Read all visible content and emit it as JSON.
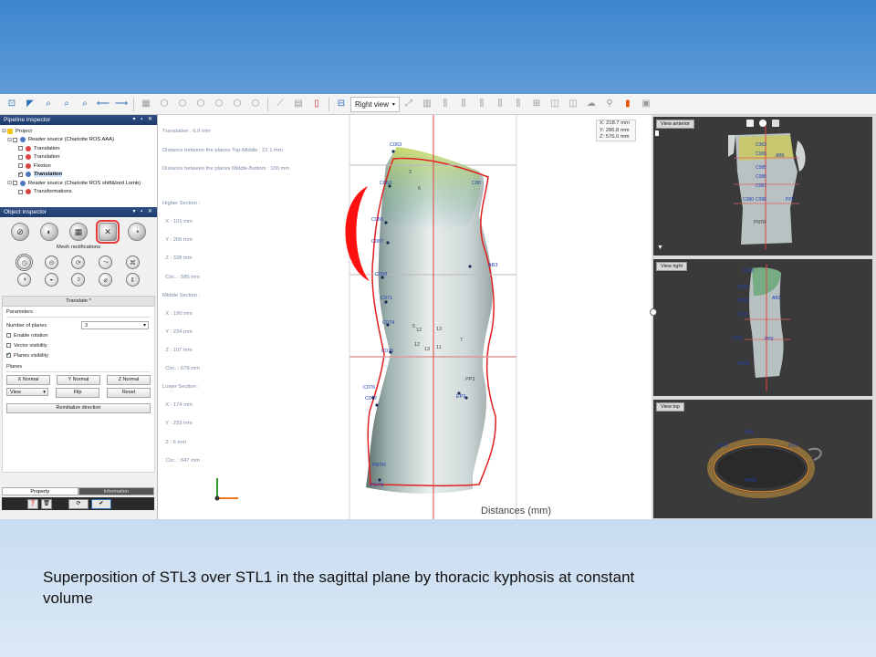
{
  "toolbar": {
    "view_select": "Right view",
    "icons": [
      "arrow-icon",
      "pointer-icon",
      "zoom-icon",
      "zoom-icon",
      "zoom-icon",
      "back-icon",
      "forward-icon",
      "grid-icon",
      "cube-icon",
      "cube-icon",
      "cube-icon",
      "cube-icon",
      "cube-icon",
      "cube-icon",
      "ruler-icon",
      "slice-icon",
      "cylinder-icon"
    ]
  },
  "pipeline_inspector": {
    "title": "Pipeline inspector",
    "items": [
      {
        "label": "Project",
        "level": 0
      },
      {
        "label": "Reader source (Charlotte ROS AAA)",
        "level": 1
      },
      {
        "label": "Translation",
        "level": 2
      },
      {
        "label": "Translation",
        "level": 2
      },
      {
        "label": "Flexion",
        "level": 2
      },
      {
        "label": "Translation",
        "level": 2,
        "selected": true
      },
      {
        "label": "Reader source (Charlotte ROS shift&lord Lomb)",
        "level": 1
      },
      {
        "label": "Transformations",
        "level": 2
      }
    ]
  },
  "object_inspector": {
    "title": "Object inspector",
    "caption": "Mesh rectifications",
    "translate_label": "Translate *",
    "parameters_title": "Parameters",
    "number_of_planes_label": "Number of planes",
    "number_of_planes_value": "3",
    "enable_rotation": "Enable rotation",
    "vector_visibility": "Vector visibility",
    "planes_visibility": "Planes visibility",
    "planes_title": "Planes",
    "x_normal": "X Normal",
    "y_normal": "Y Normal",
    "z_normal": "Z Normal",
    "view_select": "View",
    "flip": "Flip",
    "reset": "Reset",
    "reinitialize": "Reinitialize direction",
    "tab_property": "Property",
    "tab_information": "Information"
  },
  "viewport": {
    "info_lines": [
      "Translation : 6.9 mm",
      "Distance between the planes Top-Middle : 22 1 mm",
      "Distance between the planes Middle-Bottom : 100 mm",
      "",
      "Higher Section :",
      "  X : 101 mm",
      "  Y : 206 mm",
      "  Z : 328 mm",
      "  Circ. : 585 mm",
      "Middle Section :",
      "  X : 180 mm",
      "  Y : 234 mm",
      "  Z : 107 mm",
      "  Circ. : 679 mm",
      "Lower Section :",
      "  X : 174 mm",
      "  Y : 233 mm",
      "  Z : 6 mm",
      "  Circ. : 647 mm"
    ],
    "coords": {
      "x": "X: 218.7 mm",
      "y": "Y: 286.8 mm",
      "z": "Z: 576.0 mm"
    },
    "distances_label": "Distances (mm)",
    "markers_left": [
      "C063",
      "C065",
      "C067",
      "C068",
      "C071",
      "C074",
      "C075",
      "C076",
      "C077",
      "C079",
      "C081",
      "C083",
      "PNTR",
      "PNTB"
    ],
    "markers_mid": [
      "2",
      "6",
      "5",
      "12",
      "13",
      "11",
      "7",
      "12",
      "13",
      "11",
      "13",
      "8"
    ],
    "markers_right": [
      "C80",
      "AB3",
      "PP3",
      "EP2"
    ],
    "marker_top": "C063"
  },
  "right_views": {
    "anterior": {
      "label": "View anterior",
      "markers": [
        "C063",
        "C065",
        "C086",
        "C087",
        "C088",
        "C089",
        "C091",
        "PNTR",
        "AB5",
        "PP5",
        "C085",
        "C080"
      ]
    },
    "right": {
      "label": "View right",
      "markers": [
        "C063",
        "C065",
        "C080",
        "C087",
        "C088",
        "C089",
        "C091",
        "AB3",
        "PP3",
        "PNTR"
      ]
    },
    "top": {
      "label": "View top",
      "markers": [
        "AB3",
        "C070",
        "C071",
        "C073",
        "PP3",
        "PNTR"
      ]
    }
  },
  "caption": {
    "line1": "Superposition of STL3 over STL1 in the sagittal plane by thoracic kyphosis at constant",
    "line2": "volume"
  }
}
